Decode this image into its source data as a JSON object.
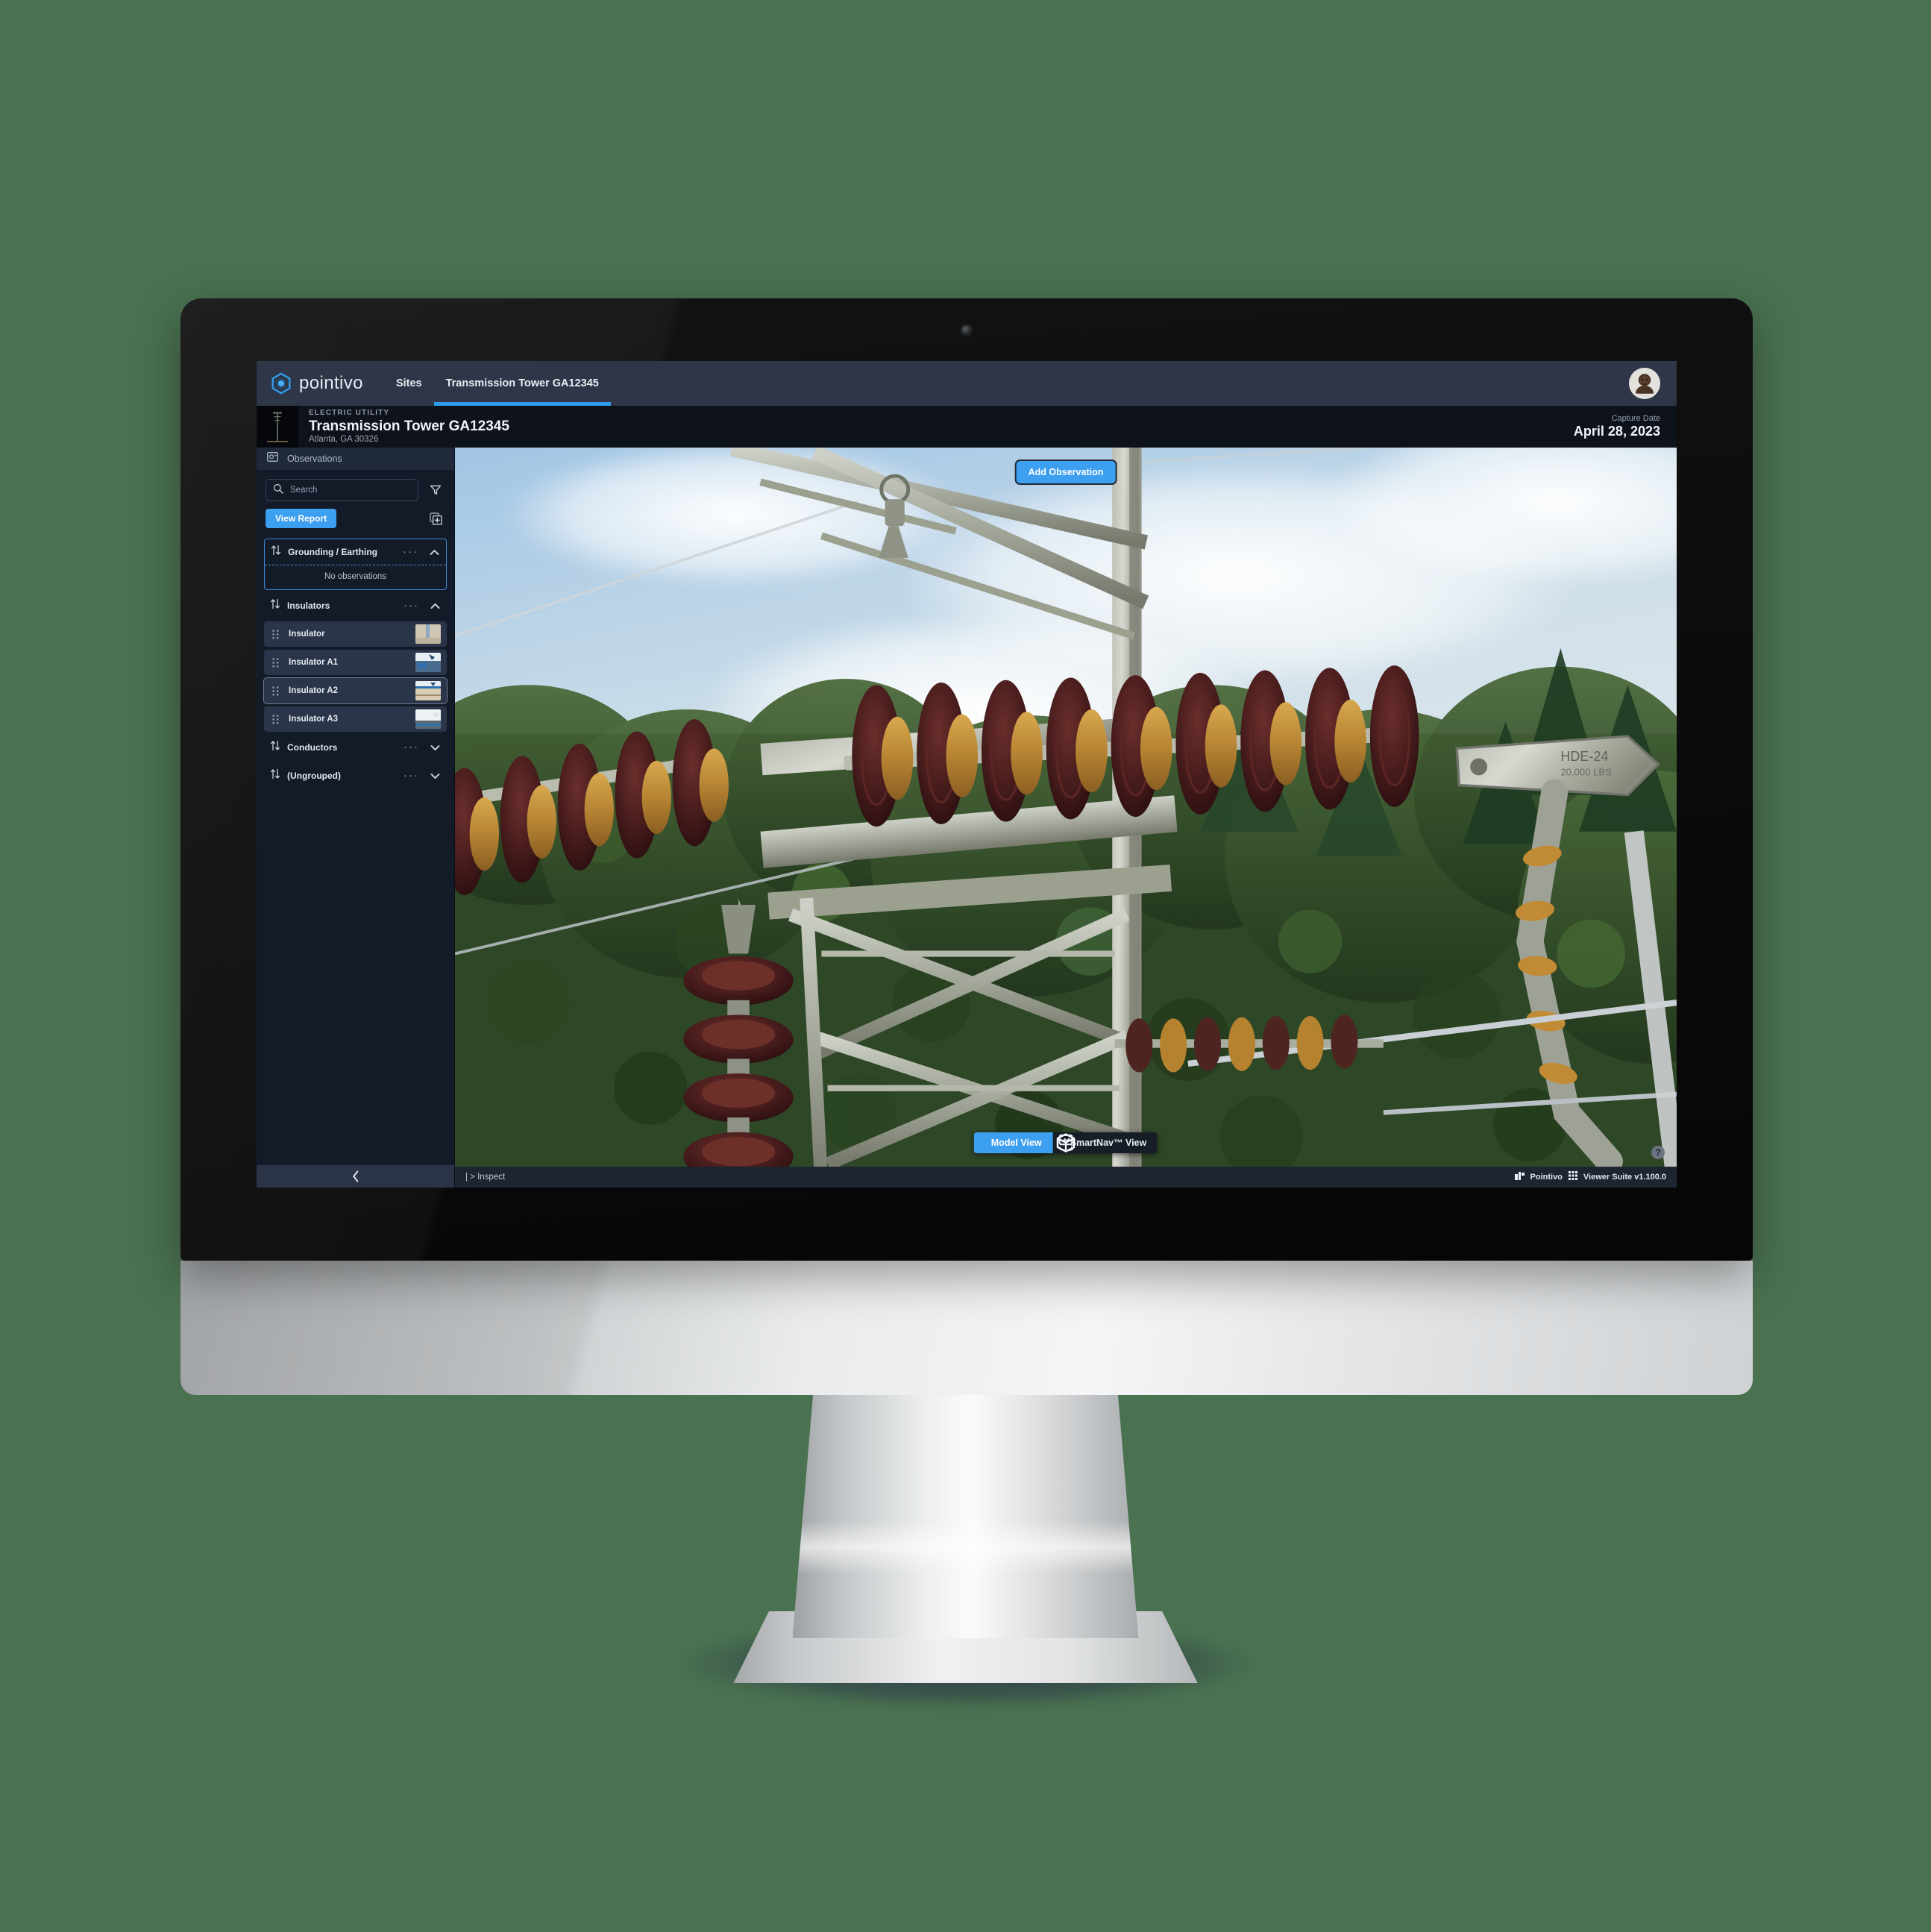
{
  "topnav": {
    "brand_name": "pointivo",
    "brand_icon": "pointivo-logo-icon",
    "tabs": [
      {
        "label": "Sites",
        "active": false
      },
      {
        "label": "Transmission Tower GA12345",
        "active": true
      }
    ],
    "avatar_icon": "user-avatar"
  },
  "site_header": {
    "kicker": "ELECTRIC UTILITY",
    "title": "Transmission Tower GA12345",
    "subtitle": "Atlanta, GA 30326",
    "capture_label": "Capture Date",
    "capture_value": "April 28, 2023",
    "thumbnail_icon": "tower-thumbnail"
  },
  "sidebar": {
    "panel_title": "Observations",
    "panel_icon": "photo-icon",
    "search": {
      "placeholder": "Search",
      "value": "",
      "icon": "search-icon"
    },
    "filter_icon": "filter-funnel-icon",
    "view_report_label": "View Report",
    "add_group_icon": "add-layer-icon",
    "collapse_icon": "chevron-left-icon",
    "groups": [
      {
        "label": "Grounding / Earthing",
        "expanded": true,
        "selected": true,
        "empty_text": "No observations",
        "items": []
      },
      {
        "label": "Insulators",
        "expanded": true,
        "selected": false,
        "items": [
          {
            "label": "Insulator",
            "active": false,
            "thumb": "a"
          },
          {
            "label": "Insulator A1",
            "active": false,
            "thumb": "b"
          },
          {
            "label": "Insulator A2",
            "active": true,
            "thumb": "c"
          },
          {
            "label": "Insulator A3",
            "active": false,
            "thumb": "d"
          }
        ]
      },
      {
        "label": "Conductors",
        "expanded": false,
        "selected": false,
        "items": []
      },
      {
        "label": "(Ungrouped)",
        "expanded": false,
        "selected": false,
        "items": []
      }
    ],
    "menu_dots": "···"
  },
  "viewer": {
    "add_observation_label": "Add Observation",
    "help_label": "?",
    "modes": [
      {
        "label": "Model View",
        "icon": "cube-icon",
        "active": true
      },
      {
        "label": "SmartNav™ View",
        "icon": "smartnav-icon",
        "active": false
      }
    ],
    "markers": [
      {
        "type": "ok",
        "x": 17.1,
        "y": 27.3,
        "icon": "check-circle-icon"
      },
      {
        "type": "ok",
        "x": 29.5,
        "y": 25.5,
        "icon": "check-circle-icon"
      },
      {
        "type": "ok",
        "x": 87.2,
        "y": 27.9,
        "icon": "check-circle-icon"
      },
      {
        "type": "warning",
        "x": 23.4,
        "y": 39.0,
        "icon": "warning-triangle-icon"
      },
      {
        "type": "ok",
        "x": 82.9,
        "y": 56.6,
        "icon": "check-circle-icon"
      }
    ]
  },
  "statusbar": {
    "breadcrumb": "| > Inspect",
    "brand": "Pointivo",
    "product": "Viewer Suite  v1.100.0",
    "brand_icon": "pointivo-small-icon",
    "grid_icon": "grid-icon"
  },
  "colors": {
    "accent": "#3d9ff0",
    "ok": "#7ed321",
    "warning": "#fbbf16",
    "marker_stroke": "#12243c",
    "desktop_bg": "#4a7150",
    "panel_bg": "#141b28",
    "topnav_bg": "#2e3647"
  }
}
